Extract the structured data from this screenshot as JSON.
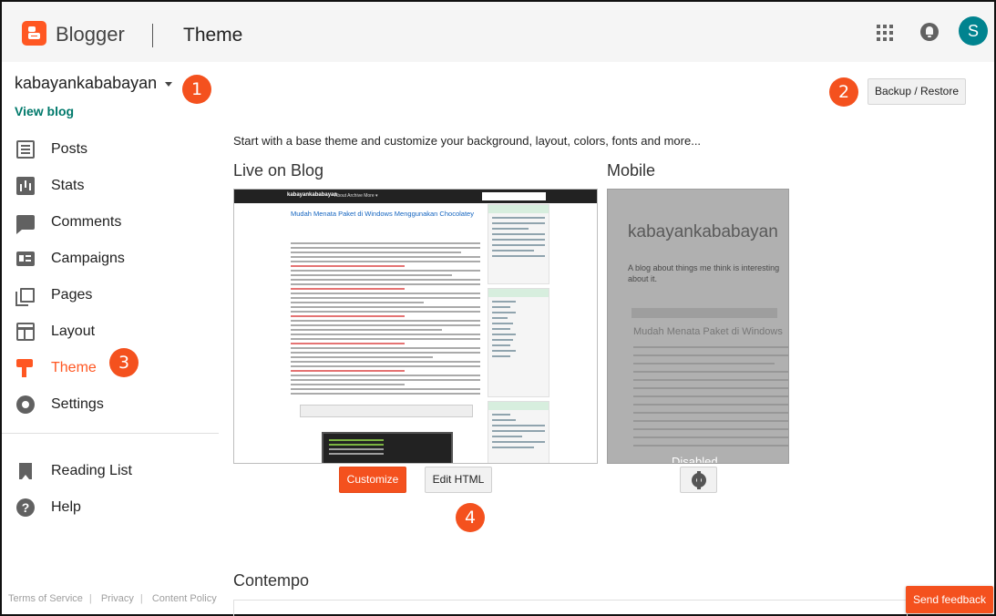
{
  "header": {
    "brand": "Blogger",
    "page_title": "Theme",
    "avatar_initial": "S"
  },
  "sidebar": {
    "blog_name": "kabayankababayan",
    "view_blog": "View blog",
    "items": [
      {
        "label": "Posts",
        "icon": "posts-icon"
      },
      {
        "label": "Stats",
        "icon": "stats-icon"
      },
      {
        "label": "Comments",
        "icon": "comments-icon"
      },
      {
        "label": "Campaigns",
        "icon": "campaigns-icon"
      },
      {
        "label": "Pages",
        "icon": "pages-icon"
      },
      {
        "label": "Layout",
        "icon": "layout-icon"
      },
      {
        "label": "Theme",
        "icon": "theme-icon",
        "active": true
      },
      {
        "label": "Settings",
        "icon": "settings-icon"
      }
    ],
    "secondary_items": [
      {
        "label": "Reading List",
        "icon": "reading-list-icon"
      },
      {
        "label": "Help",
        "icon": "help-icon"
      }
    ]
  },
  "footer_links": [
    "Terms of Service",
    "Privacy",
    "Content Policy"
  ],
  "badges": [
    "1",
    "2",
    "3",
    "4"
  ],
  "main": {
    "backup_restore": "Backup / Restore",
    "intro": "Start with a base theme and customize your background, layout, colors, fonts and more...",
    "live_heading": "Live on Blog",
    "mobile_heading": "Mobile",
    "customize_label": "Customize",
    "edit_html_label": "Edit HTML",
    "next_theme_heading": "Contempo",
    "feedback_label": "Send feedback"
  },
  "live_preview": {
    "blog_title": "kabayankababayan",
    "menu": "About   Archive   More ▾",
    "post_title": "Mudah Menata Paket di Windows Menggunakan Chocolatey"
  },
  "mobile_preview": {
    "blog_title": "kabayankababayan",
    "description": "A blog about things me think is interesting about it.",
    "post_title": "Mudah Menata Paket di Windows",
    "status": "Disabled"
  },
  "colors": {
    "accent": "#f4511e",
    "link": "#00796b",
    "avatar": "#00838f"
  }
}
